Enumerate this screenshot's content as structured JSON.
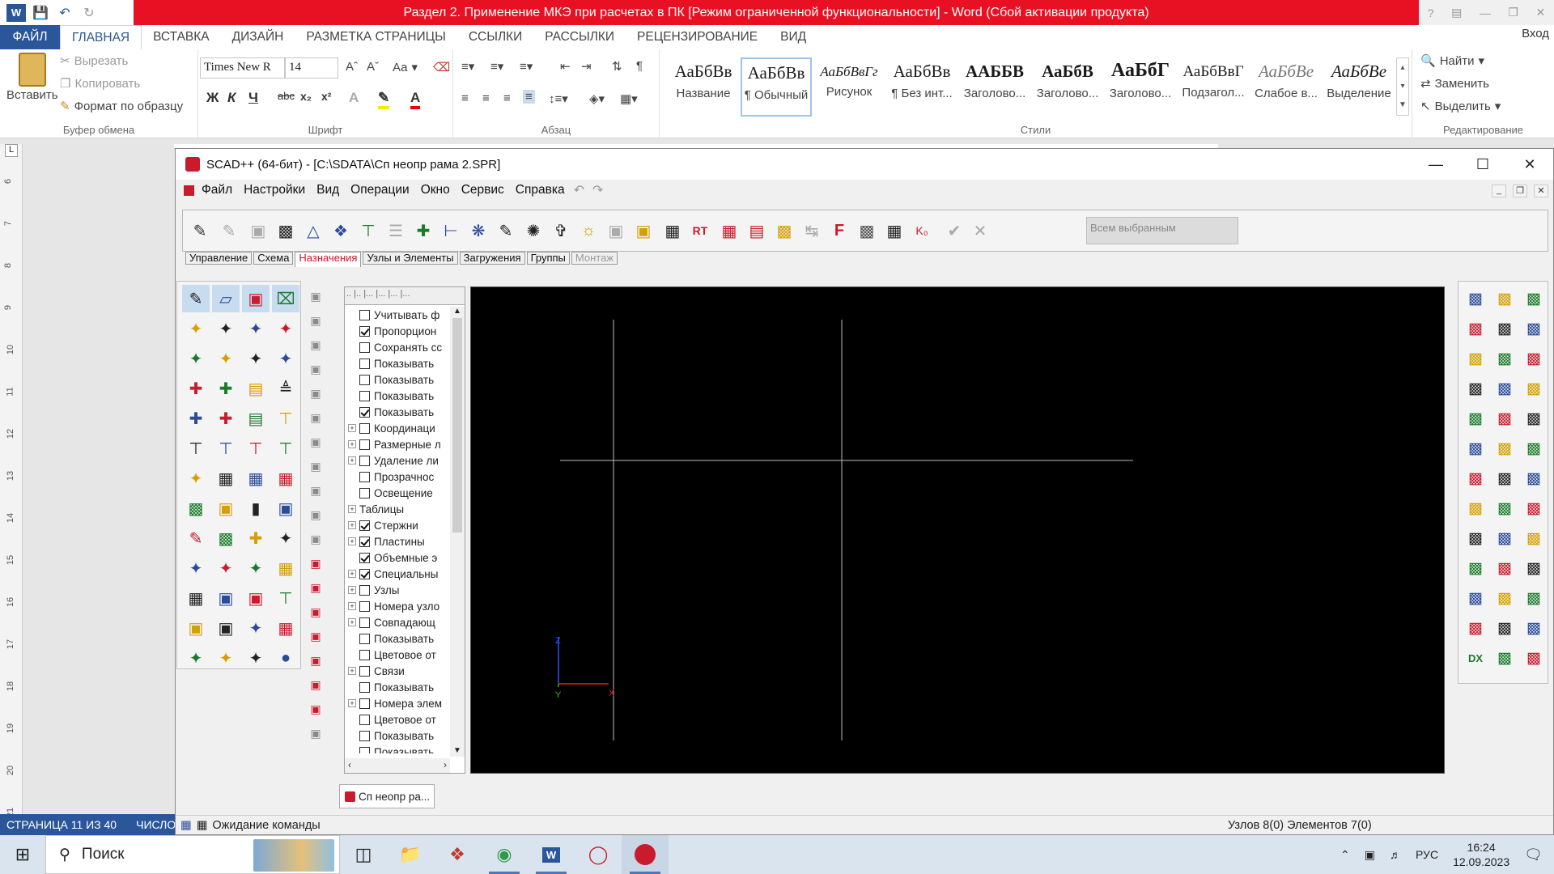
{
  "word": {
    "title": "Раздел 2. Применение МКЭ при расчетах в ПК [Режим ограниченной функциональности] -  Word (Сбой активации продукта)",
    "tabs": [
      {
        "label": "ФАЙЛ"
      },
      {
        "label": "ГЛАВНАЯ"
      },
      {
        "label": "ВСТАВКА"
      },
      {
        "label": "ДИЗАЙН"
      },
      {
        "label": "РАЗМЕТКА СТРАНИЦЫ"
      },
      {
        "label": "ССЫЛКИ"
      },
      {
        "label": "РАССЫЛКИ"
      },
      {
        "label": "РЕЦЕНЗИРОВАНИЕ"
      },
      {
        "label": "ВИД"
      }
    ],
    "login": "Вход",
    "clipboard": {
      "paste": "Вставить",
      "cut": "Вырезать",
      "copy": "Копировать",
      "format_painter": "Формат по образцу",
      "group": "Буфер обмена"
    },
    "font": {
      "name": "Times New R",
      "size": "14",
      "group": "Шрифт",
      "case": "Аа"
    },
    "paragraph": {
      "group": "Абзац"
    },
    "styles": {
      "group": "Стили",
      "items": [
        {
          "sample": "АаБбВв",
          "name": "Название"
        },
        {
          "sample": "АаБбВв",
          "name": "¶ Обычный"
        },
        {
          "sample": "АаБбВвГг",
          "name": "Рисунок"
        },
        {
          "sample": "АаБбВв",
          "name": "¶ Без инт..."
        },
        {
          "sample": "ААББВ",
          "name": "Заголово..."
        },
        {
          "sample": "АаБбВ",
          "name": "Заголово..."
        },
        {
          "sample": "АаБбГ",
          "name": "Заголово..."
        },
        {
          "sample": "АаБбВвГ",
          "name": "Подзагол..."
        },
        {
          "sample": "АаБбВе",
          "name": "Слабое в..."
        },
        {
          "sample": "АаБбВе",
          "name": "Выделение"
        }
      ]
    },
    "editing": {
      "find": "Найти",
      "replace": "Заменить",
      "select": "Выделить",
      "group": "Редактирование"
    },
    "ruler_numbers": [
      "6",
      "7",
      "8",
      "9",
      "10",
      "11",
      "12",
      "13",
      "14",
      "15",
      "16",
      "17",
      "18",
      "19",
      "20",
      "21"
    ],
    "status": {
      "page": "СТРАНИЦА 11 ИЗ 40",
      "words": "ЧИСЛО СЛ"
    }
  },
  "scad": {
    "title": "SCAD++ (64-бит) - [C:\\SDATA\\Сп неопр рама 2.SPR]",
    "menu": [
      "Файл",
      "Настройки",
      "Вид",
      "Операции",
      "Окно",
      "Сервис",
      "Справка"
    ],
    "toolbar_combo": "Всем выбранным",
    "tabs": [
      {
        "label": "Управление"
      },
      {
        "label": "Схема"
      },
      {
        "label": "Назначения"
      },
      {
        "label": "Узлы и Элементы"
      },
      {
        "label": "Загружения"
      },
      {
        "label": "Группы"
      },
      {
        "label": "Монтаж"
      }
    ],
    "tree": [
      {
        "label": "Учитывать ф",
        "checked": false,
        "exp": ""
      },
      {
        "label": "Пропорцион",
        "checked": true,
        "exp": ""
      },
      {
        "label": "Сохранять сс",
        "checked": false,
        "exp": ""
      },
      {
        "label": "Показывать",
        "checked": false,
        "exp": ""
      },
      {
        "label": "Показывать",
        "checked": false,
        "exp": ""
      },
      {
        "label": "Показывать",
        "checked": false,
        "exp": ""
      },
      {
        "label": "Показывать",
        "checked": true,
        "exp": ""
      },
      {
        "label": "Координаци",
        "checked": false,
        "exp": "+"
      },
      {
        "label": "Размерные л",
        "checked": false,
        "exp": "+"
      },
      {
        "label": "Удаление ли",
        "checked": false,
        "exp": "+"
      },
      {
        "label": "Прозрачнос",
        "checked": false,
        "exp": ""
      },
      {
        "label": "Освещение",
        "checked": false,
        "exp": ""
      },
      {
        "label": "Таблицы",
        "checked": null,
        "exp": "+"
      },
      {
        "label": "Стержни",
        "checked": true,
        "exp": "+"
      },
      {
        "label": "Пластины",
        "checked": true,
        "exp": "+"
      },
      {
        "label": "Объемные э",
        "checked": true,
        "exp": ""
      },
      {
        "label": "Специальны",
        "checked": true,
        "exp": "+"
      },
      {
        "label": "Узлы",
        "checked": false,
        "exp": "+"
      },
      {
        "label": "Номера узло",
        "checked": false,
        "exp": "+"
      },
      {
        "label": "Совпадающ",
        "checked": false,
        "exp": "+"
      },
      {
        "label": "Показывать",
        "checked": false,
        "exp": ""
      },
      {
        "label": "Цветовое от",
        "checked": false,
        "exp": ""
      },
      {
        "label": "Связи",
        "checked": false,
        "exp": "+"
      },
      {
        "label": "Показывать",
        "checked": false,
        "exp": ""
      },
      {
        "label": "Номера элем",
        "checked": false,
        "exp": "+"
      },
      {
        "label": "Цветовое от",
        "checked": false,
        "exp": ""
      },
      {
        "label": "Показывать",
        "checked": false,
        "exp": ""
      },
      {
        "label": "Показывать",
        "checked": false,
        "exp": ""
      }
    ],
    "axes": {
      "z": "Z",
      "x": "X",
      "y": "Y"
    },
    "doc_tab": "Сп неопр ра...",
    "status_left": "Ожидание команды",
    "status_right": "Узлов 8(0) Элементов 7(0)"
  },
  "taskbar": {
    "search": "Поиск",
    "lang": "РУС",
    "time": "16:24",
    "date": "12.09.2023"
  },
  "colors": {
    "word_blue": "#2b579a",
    "title_red": "#e81123",
    "scad_red": "#c91b2b"
  }
}
